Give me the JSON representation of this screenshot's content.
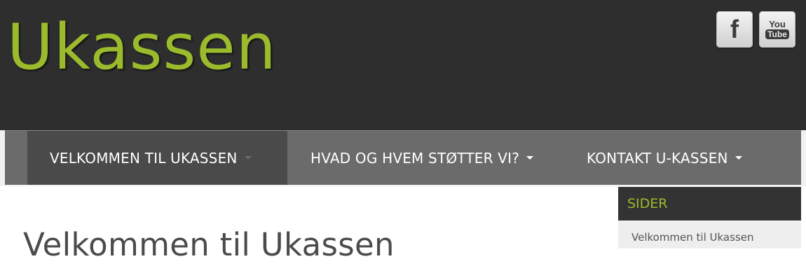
{
  "site": {
    "title": "Ukassen"
  },
  "social": [
    {
      "name": "facebook",
      "label": "f",
      "icon": "facebook-icon"
    },
    {
      "name": "youtube",
      "label_top": "You",
      "label_bottom": "Tube",
      "icon": "youtube-icon"
    }
  ],
  "nav": {
    "items": [
      {
        "label": "VELKOMMEN TIL UKASSEN",
        "active": true
      },
      {
        "label": "HVAD OG HVEM STØTTER VI?",
        "has_dropdown": true
      },
      {
        "label": "KONTAKT U-KASSEN",
        "has_dropdown": true
      }
    ]
  },
  "main": {
    "title": "Velkommen til Ukassen"
  },
  "sidebar": {
    "widget_title": "SIDER",
    "links": [
      "Velkommen til Ukassen"
    ]
  },
  "colors": {
    "accent": "#9bbb2c",
    "header_bg": "#2e2e2e",
    "nav_bg": "#6b6b6b",
    "nav_active_bg": "#4a4a4a"
  }
}
